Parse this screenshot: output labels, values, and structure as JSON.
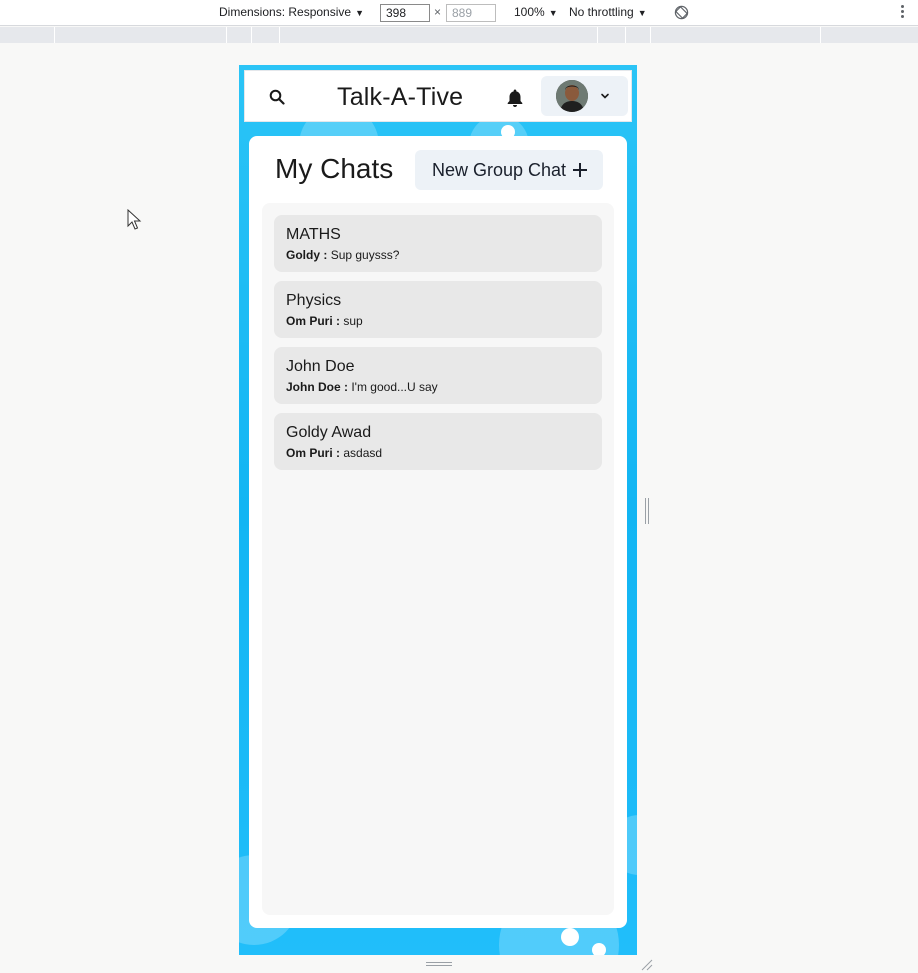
{
  "devtools": {
    "dimensions_label": "Dimensions: Responsive",
    "width_value": "398",
    "height_placeholder": "889",
    "times": "×",
    "zoom": "100%",
    "throttling": "No throttling"
  },
  "header": {
    "title": "Talk-A-Tive"
  },
  "panel": {
    "title": "My Chats",
    "new_group_label": "New Group Chat"
  },
  "chats": [
    {
      "name": "MATHS",
      "sender": "Goldy :",
      "message": "Sup guysss?"
    },
    {
      "name": "Physics",
      "sender": "Om Puri :",
      "message": "sup"
    },
    {
      "name": "John Doe",
      "sender": "John Doe :",
      "message": "I'm good...U say"
    },
    {
      "name": "Goldy Awad",
      "sender": "Om Puri :",
      "message": "asdasd"
    }
  ],
  "icons": {
    "search": "search-icon",
    "bell": "bell-icon",
    "chevron": "chevron-down-icon",
    "plus": "plus-icon",
    "rotate": "rotate-icon",
    "more": "kebab-icon"
  },
  "colors": {
    "background_gradient": "#12b5f3",
    "button_bg": "#edf2f7",
    "chat_item_bg": "#e8e8e8"
  }
}
